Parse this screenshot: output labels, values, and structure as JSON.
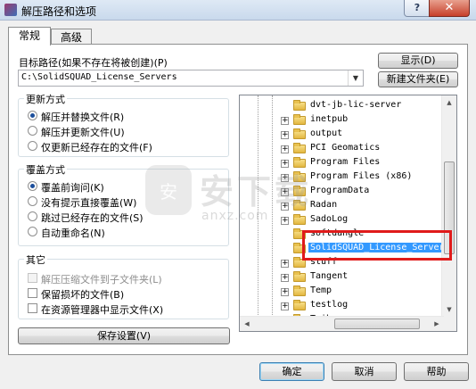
{
  "window": {
    "title": "解压路径和选项",
    "help_glyph": "?",
    "close_glyph": "✕"
  },
  "tabs": [
    {
      "label": "常规",
      "active": true
    },
    {
      "label": "高级",
      "active": false
    }
  ],
  "target": {
    "label": "目标路径(如果不存在将被创建)(P)",
    "value": "C:\\SolidSQUAD_License_Servers",
    "show_button": "显示(D)",
    "new_folder_button": "新建文件夹(E)"
  },
  "update_mode": {
    "title": "更新方式",
    "options": [
      {
        "label": "解压并替换文件(R)",
        "selected": true
      },
      {
        "label": "解压并更新文件(U)",
        "selected": false
      },
      {
        "label": "仅更新已经存在的文件(F)",
        "selected": false
      }
    ]
  },
  "overwrite_mode": {
    "title": "覆盖方式",
    "options": [
      {
        "label": "覆盖前询问(K)",
        "selected": true
      },
      {
        "label": "没有提示直接覆盖(W)",
        "selected": false
      },
      {
        "label": "跳过已经存在的文件(S)",
        "selected": false
      },
      {
        "label": "自动重命名(N)",
        "selected": false
      }
    ]
  },
  "misc": {
    "title": "其它",
    "options": [
      {
        "label": "解压压缩文件到子文件夹(L)",
        "checked": false,
        "disabled": true
      },
      {
        "label": "保留损坏的文件(B)",
        "checked": false,
        "disabled": false
      },
      {
        "label": "在资源管理器中显示文件(X)",
        "checked": false,
        "disabled": false
      }
    ]
  },
  "save_settings_button": "保存设置(V)",
  "tree": {
    "items": [
      {
        "name": "dvt-jb-lic-server",
        "expander": false,
        "selected": false
      },
      {
        "name": "inetpub",
        "expander": true,
        "selected": false
      },
      {
        "name": "output",
        "expander": true,
        "selected": false
      },
      {
        "name": "PCI Geomatics",
        "expander": true,
        "selected": false
      },
      {
        "name": "Program Files",
        "expander": true,
        "selected": false
      },
      {
        "name": "Program Files (x86)",
        "expander": true,
        "selected": false
      },
      {
        "name": "ProgramData",
        "expander": true,
        "selected": false
      },
      {
        "name": "Radan",
        "expander": true,
        "selected": false
      },
      {
        "name": "SadoLog",
        "expander": true,
        "selected": false
      },
      {
        "name": "softdangle",
        "expander": false,
        "selected": false
      },
      {
        "name": "SolidSQUAD_License_Servers",
        "expander": false,
        "selected": true
      },
      {
        "name": "stuff",
        "expander": true,
        "selected": false
      },
      {
        "name": "Tangent",
        "expander": true,
        "selected": false
      },
      {
        "name": "Temp",
        "expander": true,
        "selected": false
      },
      {
        "name": "testlog",
        "expander": true,
        "selected": false
      },
      {
        "name": "Tribon",
        "expander": true,
        "selected": false
      }
    ],
    "expand_glyph": "+",
    "up_arrow": "▲",
    "down_arrow": "▼",
    "left_arrow": "◀",
    "right_arrow": "▶"
  },
  "footer": {
    "ok": "确定",
    "cancel": "取消",
    "help": "帮助"
  },
  "watermark": {
    "logo_text": "安",
    "big": "安下载",
    "sub": "anxz.com"
  },
  "colors": {
    "selection": "#3399ff",
    "highlight_box": "#e01b1b"
  }
}
